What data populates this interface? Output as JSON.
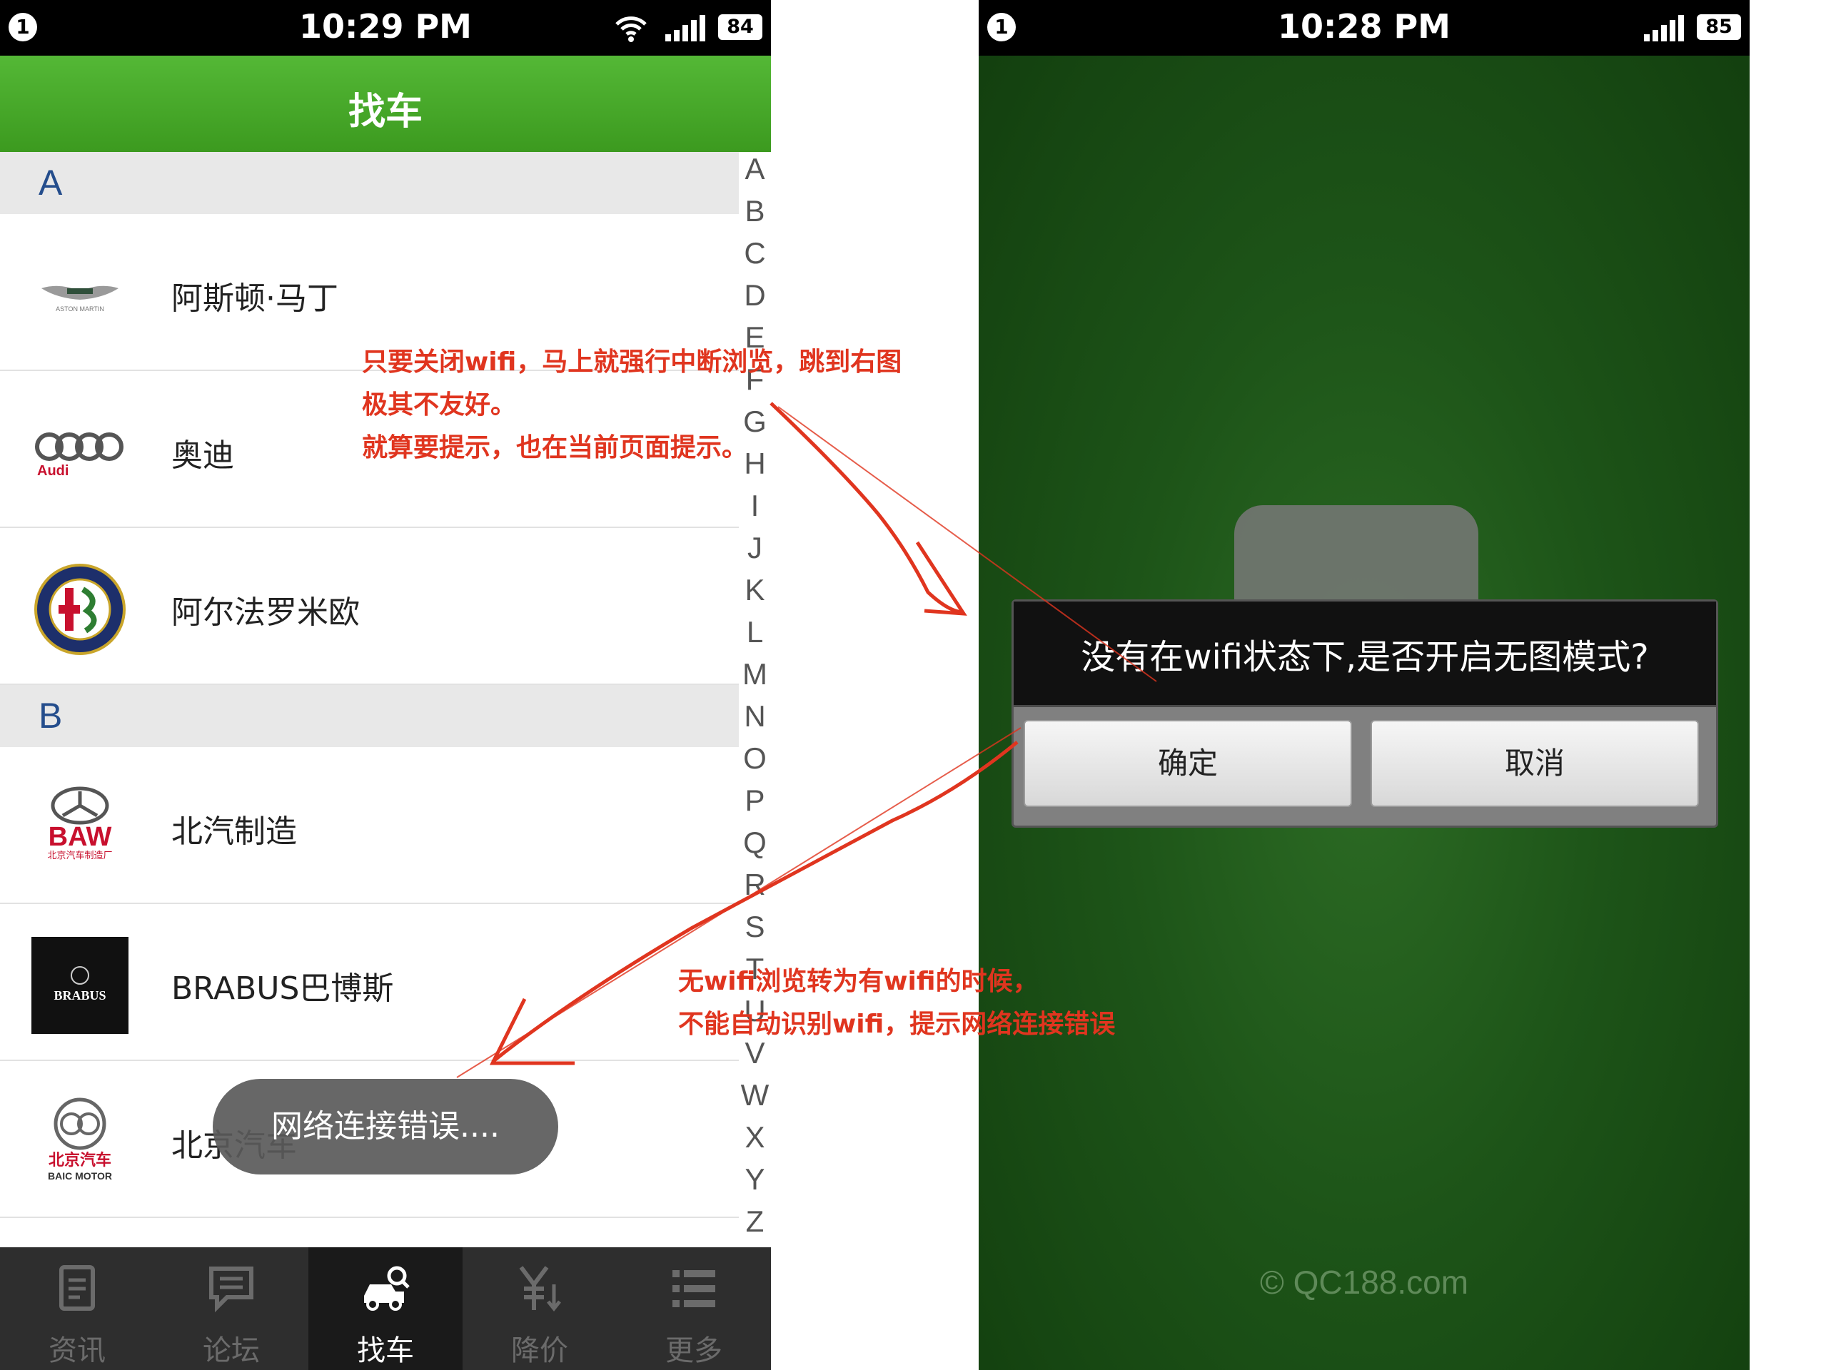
{
  "left": {
    "status": {
      "badge": "1",
      "time": "10:29 PM",
      "battery": "84"
    },
    "title": "找车",
    "sections": [
      {
        "letter": "A",
        "brands": [
          "阿斯顿·马丁",
          "奥迪",
          "阿尔法罗米欧"
        ]
      },
      {
        "letter": "B",
        "brands": [
          "北汽制造",
          "BRABUS巴博斯",
          "北京汽车"
        ]
      }
    ],
    "logo_text": {
      "aston": "ASTON MARTIN",
      "audi": "Audi",
      "baw": "BAW",
      "baw_sub": "北京汽车制造厂",
      "brabus": "BRABUS",
      "baic_cn": "北京汽车",
      "baic_en": "BAIC MOTOR"
    },
    "index": [
      "A",
      "B",
      "C",
      "D",
      "E",
      "F",
      "G",
      "H",
      "I",
      "J",
      "K",
      "L",
      "M",
      "N",
      "O",
      "P",
      "Q",
      "R",
      "S",
      "T",
      "U",
      "V",
      "W",
      "X",
      "Y",
      "Z"
    ],
    "toast": "网络连接错误....",
    "tabs": [
      "资讯",
      "论坛",
      "找车",
      "降价",
      "更多"
    ],
    "active_tab": 2
  },
  "right": {
    "status": {
      "badge": "1",
      "time": "10:28 PM",
      "battery": "85"
    },
    "dialog": {
      "message": "没有在wifi状态下,是否开启无图模式?",
      "confirm": "确定",
      "cancel": "取消"
    },
    "copyright": "© QC188.com"
  },
  "annotations": {
    "note1": [
      "只要关闭wifi，马上就强行中断浏览，跳到右图",
      "极其不友好。",
      "就算要提示，也在当前页面提示。"
    ],
    "note2": [
      "无wifi浏览转为有wifi的时候，",
      "不能自动识别wifi，提示网络连接错误"
    ]
  },
  "colors": {
    "title_green": "#3c9a1f",
    "section_letter": "#244d8c",
    "annotation_red": "#e0351f",
    "splash_green": "#1d5418"
  }
}
